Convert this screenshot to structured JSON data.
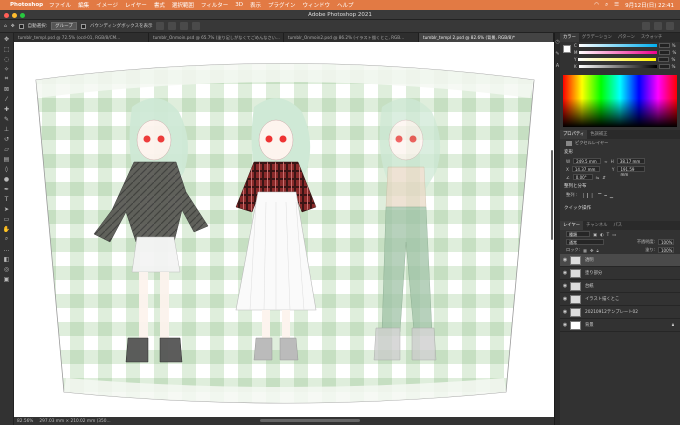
{
  "menubar": {
    "app": "Photoshop",
    "items": [
      "ファイル",
      "編集",
      "イメージ",
      "レイヤー",
      "書式",
      "選択範囲",
      "フィルター",
      "3D",
      "表示",
      "プラグイン",
      "ウィンドウ",
      "ヘルプ"
    ],
    "clock": "9月12日(日) 22:41"
  },
  "window": {
    "title": "Adobe Photoshop 2021"
  },
  "options": {
    "auto_select": "自動選択:",
    "group": "グループ",
    "transform": "バウンディングボックスを表示"
  },
  "tabs": [
    "tumblr_templ.psd @ 72.5% (ocd-01, RGB/8/CM...",
    "tumblr_Onmoin.psd @ 65.7% (塗り足しがなくてごめんなさい...",
    "tumblr_Onmoin2.psd @ 86.2% (イラスト描くとこ, RGB...",
    "tumblr_templ 2.psd @ 82.6% (背景, RGB/8)*"
  ],
  "status": {
    "zoom": "82.56%",
    "size": "297.03 mm × 210.02 mm (350..."
  },
  "color_panel": {
    "tabs": [
      "カラー",
      "グラデーション",
      "パターン",
      "スウォッチ"
    ],
    "labels": [
      "C",
      "M",
      "Y",
      "K"
    ],
    "suffix": "%"
  },
  "properties": {
    "tabs": [
      "プロパティ",
      "色調補正"
    ],
    "kind": "ピクセルレイヤー",
    "transform": "変形",
    "w_label": "W",
    "w": "249.5 mm",
    "h_label": "H",
    "h": "38.17 mm",
    "x_label": "X",
    "x": "14.37 mm",
    "y_label": "Y",
    "y": "191.59 mm",
    "angle": "0.00°",
    "align_title": "整列と分布",
    "align_label": "整列 :",
    "quick_title": "クイック操作"
  },
  "layers_panel": {
    "tabs": [
      "レイヤー",
      "チャンネル",
      "パス"
    ],
    "kind": "種類",
    "blend": "通常",
    "opacity_label": "不透明度:",
    "opacity": "100%",
    "lock_label": "ロック:",
    "fill_label": "塗り:",
    "fill": "100%",
    "layers": [
      "透明",
      "塗り部分",
      "台紙",
      "イラスト描くとこ",
      "20210912テンプレート02",
      "背景"
    ]
  }
}
